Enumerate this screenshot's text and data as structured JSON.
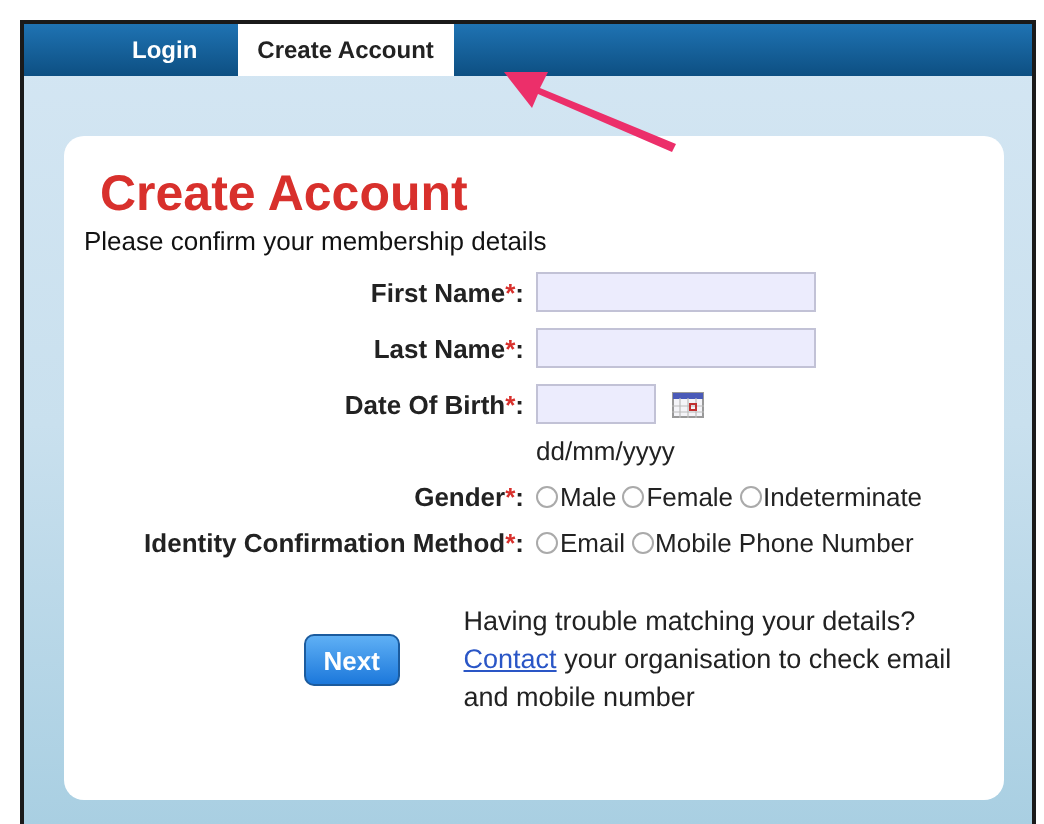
{
  "tabs": [
    {
      "label": "Login",
      "selected": false
    },
    {
      "label": "Create Account",
      "selected": true
    }
  ],
  "form": {
    "title": "Create Account",
    "subtitle": "Please confirm your membership details",
    "fields": [
      {
        "kind": "text",
        "label": "First Name",
        "required_mark": "*",
        "colon": ":"
      },
      {
        "kind": "text",
        "label": "Last Name",
        "required_mark": "*",
        "colon": ":"
      },
      {
        "kind": "date",
        "label": "Date Of Birth",
        "required_mark": "*",
        "colon": ":",
        "hint": "dd/mm/yyyy"
      },
      {
        "kind": "radio",
        "label": "Gender",
        "required_mark": "*",
        "colon": ":",
        "options": [
          {
            "label": "Male",
            "selected": false
          },
          {
            "label": "Female",
            "selected": false
          },
          {
            "label": "Indeterminate",
            "selected": false
          }
        ]
      },
      {
        "kind": "radio",
        "label": "Identity Confirmation Method",
        "required_mark": "*",
        "colon": ":",
        "options": [
          {
            "label": "Email",
            "selected": false
          },
          {
            "label": "Mobile Phone Number",
            "selected": false
          }
        ]
      }
    ],
    "next_button": "Next",
    "help": {
      "text_before": "Having trouble matching your details?",
      "link": "Contact",
      "text_after": "your organisation to check email and mobile number"
    }
  }
}
